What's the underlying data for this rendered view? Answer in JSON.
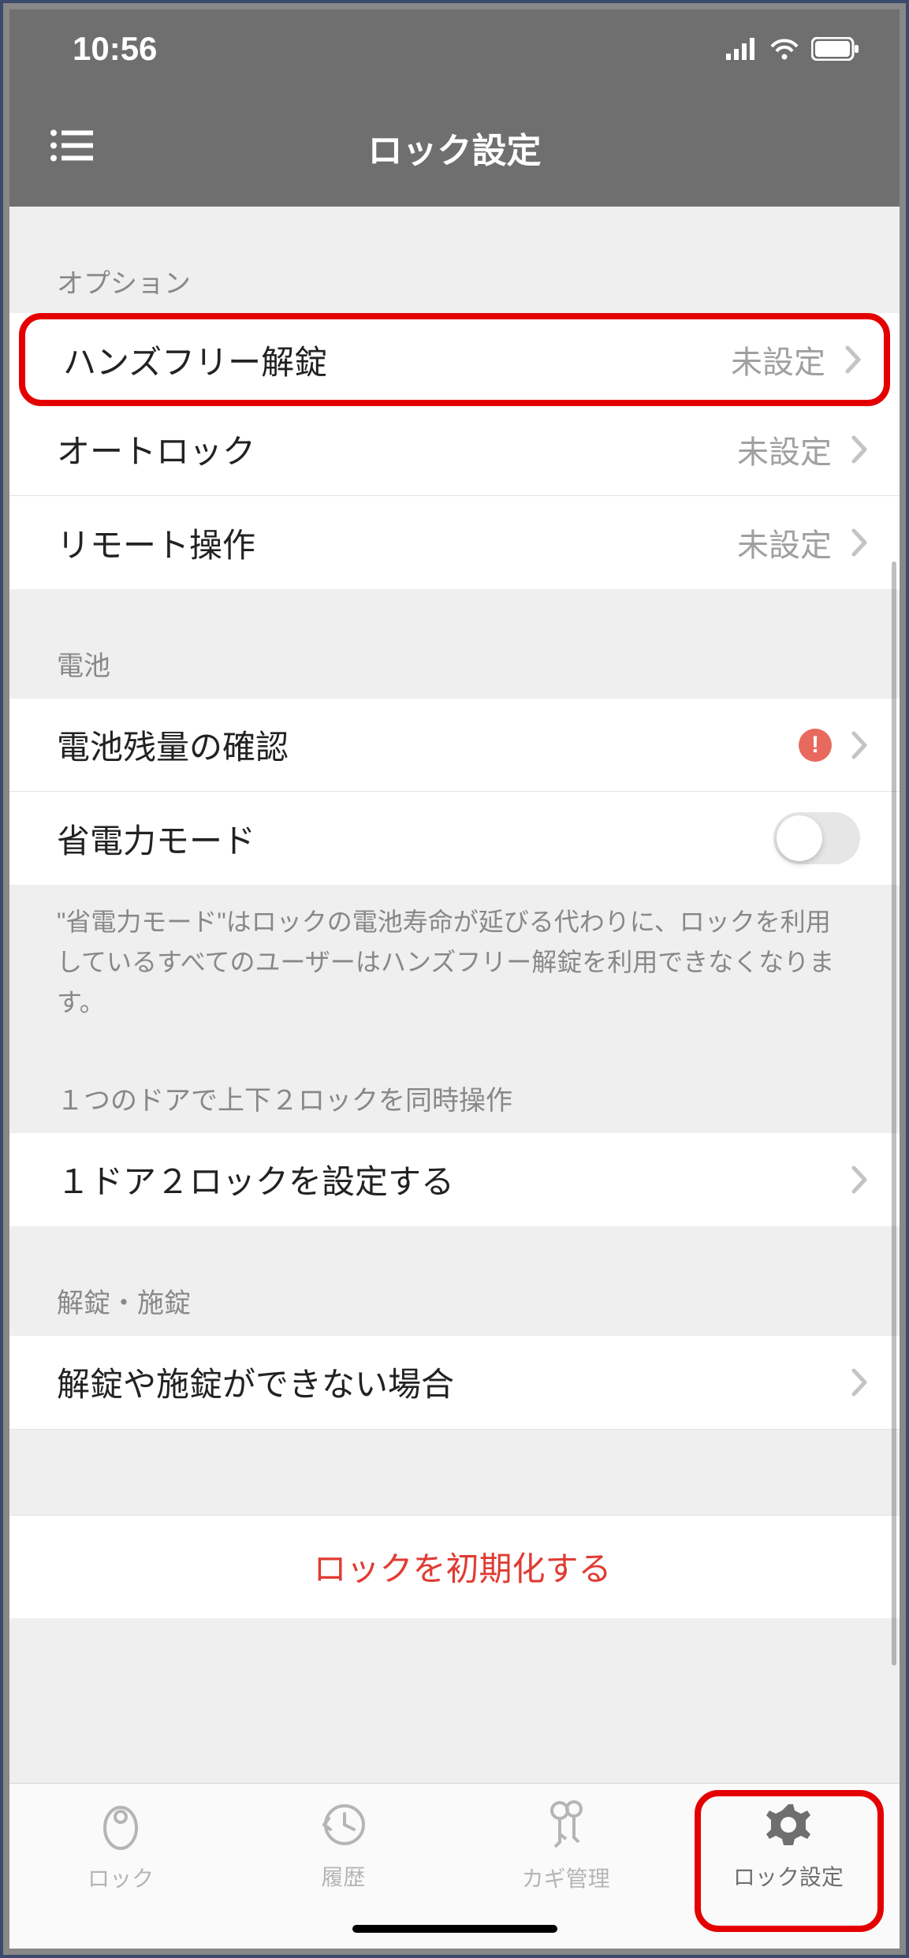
{
  "status": {
    "time": "10:56"
  },
  "header": {
    "title": "ロック設定"
  },
  "sections": {
    "options": {
      "header": "オプション",
      "handsfree": {
        "label": "ハンズフリー解錠",
        "value": "未設定"
      },
      "autolock": {
        "label": "オートロック",
        "value": "未設定"
      },
      "remote": {
        "label": "リモート操作",
        "value": "未設定"
      }
    },
    "battery": {
      "header": "電池",
      "check": {
        "label": "電池残量の確認"
      },
      "saver": {
        "label": "省電力モード"
      },
      "footer": "\"省電力モード\"はロックの電池寿命が延びる代わりに、ロックを利用しているすべてのユーザーはハンズフリー解錠を利用できなくなります。"
    },
    "dual": {
      "header": "１つのドアで上下２ロックを同時操作",
      "item": {
        "label": "１ドア２ロックを設定する"
      }
    },
    "unlock": {
      "header": "解錠・施錠",
      "item": {
        "label": "解錠や施錠ができない場合"
      }
    },
    "reset": {
      "label": "ロックを初期化する"
    }
  },
  "tabs": {
    "lock": "ロック",
    "history": "履歴",
    "keys": "カギ管理",
    "settings": "ロック設定"
  }
}
